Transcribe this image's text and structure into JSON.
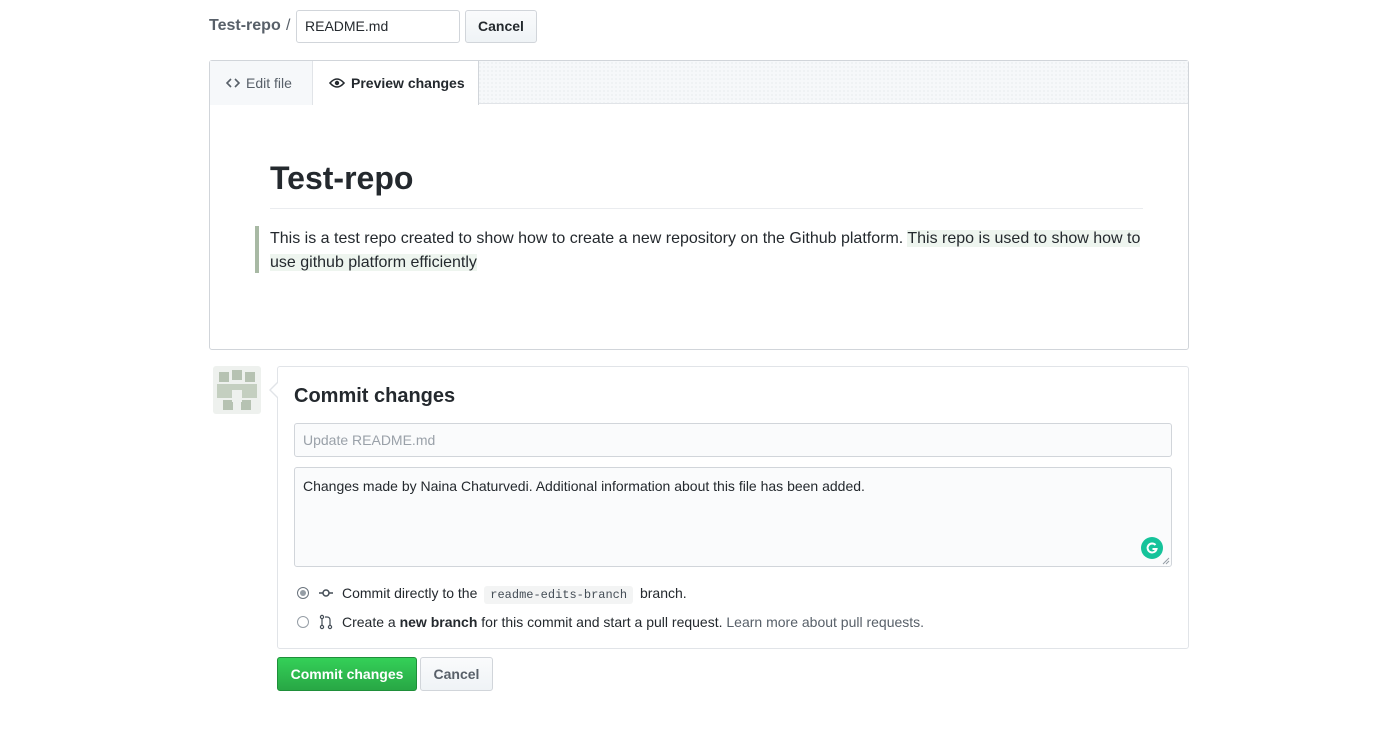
{
  "header": {
    "repo_name": "Test-repo",
    "separator": "/",
    "filename_value": "README.md",
    "cancel_label": "Cancel"
  },
  "tabs": [
    {
      "label": "Edit file",
      "icon": "code-icon",
      "active": false
    },
    {
      "label": "Preview changes",
      "icon": "eye-icon",
      "active": true
    }
  ],
  "preview": {
    "heading": "Test-repo",
    "quote_plain": "This is a test repo created to show how to create a new repository on the Github platform. ",
    "quote_highlighted": "This repo is used to show how to use github platform efficiently"
  },
  "commit": {
    "title": "Commit changes",
    "summary_placeholder": "Update README.md",
    "description_value": "Changes made by Naina Chaturvedi. Additional information about this file has been added.",
    "options": {
      "direct_prefix": "Commit directly to the",
      "direct_branch": "readme-edits-branch",
      "direct_suffix": "branch.",
      "new_prefix": "Create a",
      "new_bold": "new branch",
      "new_suffix": "for this commit and start a pull request.",
      "new_link": "Learn more about pull requests."
    },
    "selected_option": "direct",
    "submit_label": "Commit changes",
    "cancel_label": "Cancel"
  },
  "colors": {
    "primary_green": "#28a745",
    "link_gray": "#586069",
    "quote_border": "#a8b9a4",
    "grammarly": "#15c39a"
  }
}
